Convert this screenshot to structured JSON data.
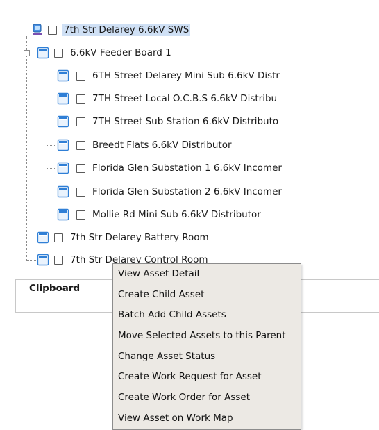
{
  "tree": {
    "root": {
      "label": "7th Str Delarey 6.6kV SWS",
      "icon": "server-icon"
    },
    "feeder_board": {
      "label": "6.6kV Feeder Board 1",
      "children": [
        "6TH Street Delarey Mini Sub 6.6kV Distr",
        "7TH Street Local O.C.B.S 6.6kV Distribu",
        "7TH Street Sub Station 6.6kV Distributo",
        "Breedt Flats 6.6kV Distributor",
        "Florida Glen Substation 1 6.6kV Incomer",
        "Florida Glen Substation 2 6.6kV Incomer",
        "Mollie Rd Mini Sub 6.6kV Distributor"
      ]
    },
    "siblings": [
      "7th Str Delarey Battery Room",
      "7th Str Delarey Control Room"
    ]
  },
  "clipboard": {
    "title": "Clipboard"
  },
  "context_menu": {
    "items": [
      "View Asset Detail",
      "Create Child Asset",
      "Batch Add Child Assets",
      "Move Selected Assets to this Parent",
      "Change Asset Status",
      "Create Work Request for Asset",
      "Create Work Order for Asset",
      "View Asset on Work Map"
    ]
  },
  "colors": {
    "selection": "#cfe0f5",
    "menu_background": "#ece9e4",
    "doc_icon_blue": "#2f7fd6"
  }
}
